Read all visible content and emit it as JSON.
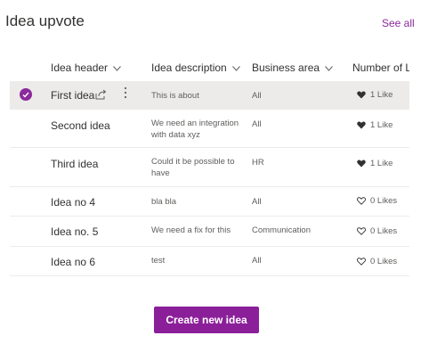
{
  "title": "Idea upvote",
  "see_all": "See all",
  "columns": [
    "Idea header",
    "Idea description",
    "Business area",
    "Number of Li"
  ],
  "rows": [
    {
      "header": "First idea",
      "description": "This is about",
      "area": "All",
      "likes": "1 Like",
      "liked": true,
      "selected": true
    },
    {
      "header": "Second idea",
      "description": "We need an integration with data xyz",
      "area": "All",
      "likes": "1 Like",
      "liked": true,
      "selected": false
    },
    {
      "header": "Third idea",
      "description": "Could it be possible to have",
      "area": "HR",
      "likes": "1 Like",
      "liked": true,
      "selected": false
    },
    {
      "header": "Idea no 4",
      "description": "bla bla",
      "area": "All",
      "likes": "0 Likes",
      "liked": false,
      "selected": false
    },
    {
      "header": "Idea no. 5",
      "description": "We need a fix for this",
      "area": "Communication",
      "likes": "0 Likes",
      "liked": false,
      "selected": false
    },
    {
      "header": "Idea no 6",
      "description": "test",
      "area": "All",
      "likes": "0 Likes",
      "liked": false,
      "selected": false
    }
  ],
  "create_button": "Create new idea",
  "colors": {
    "accent": "#8b2a9c",
    "selected_row": "#edebe9"
  },
  "icons": {
    "chevron": "chevron-down-icon",
    "share": "share-icon",
    "more": "more-vertical-icon",
    "heart_filled": "heart-filled-icon",
    "heart_outline": "heart-outline-icon",
    "check": "checkmark-circle-icon"
  }
}
